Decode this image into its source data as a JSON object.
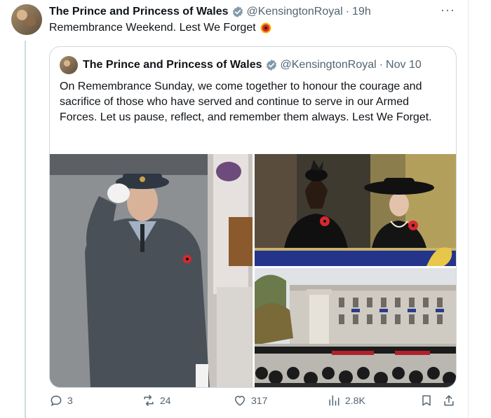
{
  "tweet": {
    "display_name": "The Prince and Princess of Wales",
    "handle": "@KensingtonRoyal",
    "separator": "·",
    "time": "19h",
    "more_label": "···",
    "text": "Remembrance Weekend. Lest We Forget"
  },
  "quoted": {
    "display_name": "The Prince and Princess of Wales",
    "handle": "@KensingtonRoyal",
    "separator": "·",
    "time": "Nov 10",
    "text": "On Remembrance Sunday, we come together to honour the courage and sacrifice of those who have served and continue to serve in our Armed Forces. Let us pause, reflect, and remember them always. Lest We Forget."
  },
  "actions": {
    "replies": "3",
    "reposts": "24",
    "likes": "317",
    "views": "2.8K"
  },
  "icons": [
    "verified-badge-icon",
    "more-icon",
    "poppy-emoji-icon",
    "reply-icon",
    "repost-icon",
    "like-icon",
    "views-icon",
    "bookmark-icon",
    "share-icon"
  ],
  "colors": {
    "text": "#0f1419",
    "secondary": "#536471",
    "verified": "#829aab",
    "border": "#cfd9de",
    "poppy": "#d9272e"
  }
}
